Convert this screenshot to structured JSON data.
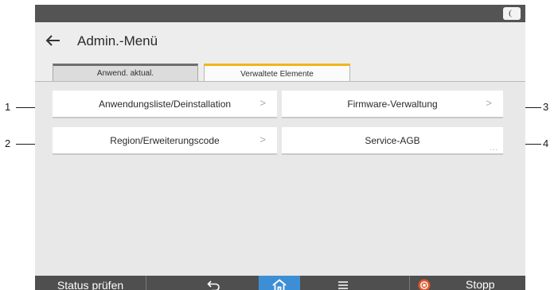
{
  "header": {
    "title": "Admin.-Menü"
  },
  "tabs": [
    {
      "label": "Anwend. aktual.",
      "active": false
    },
    {
      "label": "Verwaltete Elemente",
      "active": true
    }
  ],
  "items": [
    {
      "label": "Anwendungsliste/Deinstallation",
      "indicator": ">"
    },
    {
      "label": "Region/Erweiterungscode",
      "indicator": ">"
    },
    {
      "label": "Firmware-Verwaltung",
      "indicator": ">"
    },
    {
      "label": "Service-AGB",
      "indicator": "..."
    }
  ],
  "bottom_bar": {
    "status_label": "Status prüfen",
    "stop_label": "Stopp",
    "icons": [
      "back-arrow-icon",
      "home-icon",
      "menu-icon",
      "stop-icon"
    ]
  },
  "top_bar": {
    "icons": [
      "moon-icon"
    ]
  },
  "callouts": [
    "1",
    "2",
    "3",
    "4"
  ],
  "colors": {
    "active_tab_accent": "#f3b516",
    "home_button": "#3d8fd5",
    "bars": "#545454",
    "stop_icon": "#e2572c"
  }
}
